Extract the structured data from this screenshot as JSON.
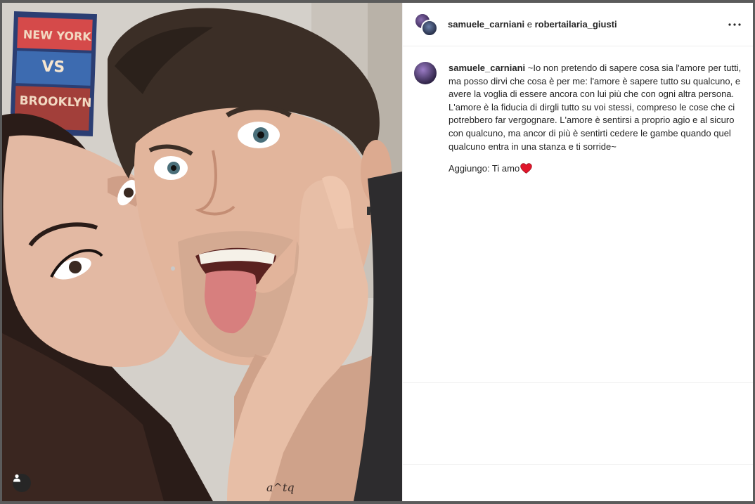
{
  "post": {
    "header": {
      "user1": "samuele_carniani",
      "joiner": " e ",
      "user2": "robertailaria_giusti"
    },
    "caption": {
      "username": "samuele_carniani",
      "text": " ~Io non pretendo di sapere cosa sia l'amore per tutti, ma posso dirvi che cosa è per me: l'amore è sapere tutto su qualcuno, e avere la voglia di essere ancora con lui più che con ogni altra persona. L'amore è la fiducia di dirgli tutto su voi stessi, compreso le cose che ci potrebbero far vergognare. L'amore è sentirsi a proprio agio e al sicuro con qualcuno, ma ancor di più è sentirti cedere le gambe quando quel qualcuno entra in una stanza e ti sorride~",
      "addendum": "Aggiungo: Ti amo"
    },
    "poster": {
      "line1": "NEW YORK",
      "line2": "VS",
      "line3": "BROOKLYN"
    },
    "tattoo": "a^tq",
    "icons": {
      "more": "more-options-icon",
      "heart": "red-heart-emoji",
      "tag": "user-tag-icon"
    },
    "colors": {
      "heart": "#e0162b",
      "text": "#262626",
      "border": "#efefef"
    }
  }
}
